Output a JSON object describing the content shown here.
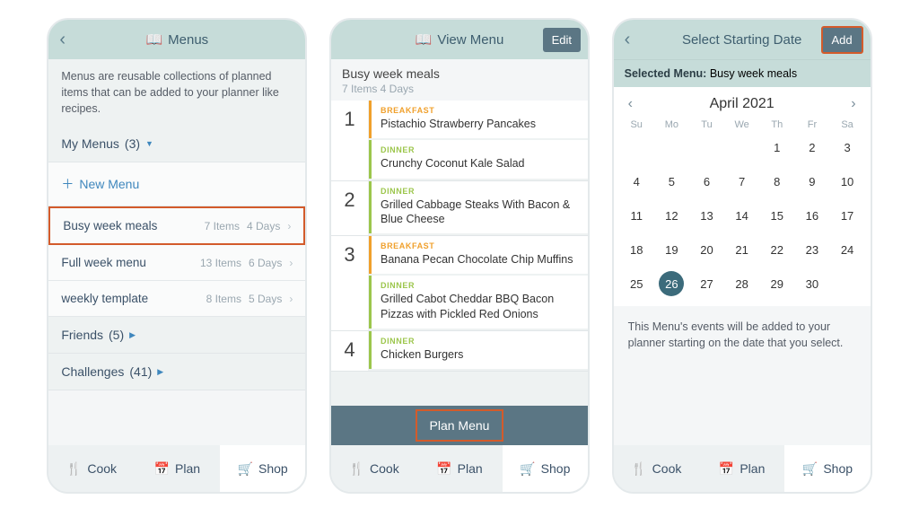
{
  "phone1": {
    "title": "Menus",
    "desc": "Menus are reusable collections of planned items that can be added to your planner like recipes.",
    "myMenus": {
      "label": "My Menus",
      "count": "(3)"
    },
    "newMenu": "New Menu",
    "rows": [
      {
        "name": "Busy week meals",
        "items": "7 Items",
        "days": "4 Days",
        "highlight": true
      },
      {
        "name": "Full week menu",
        "items": "13 Items",
        "days": "6 Days",
        "highlight": false
      },
      {
        "name": "weekly template",
        "items": "8 Items",
        "days": "5 Days",
        "highlight": false
      }
    ],
    "friends": {
      "label": "Friends",
      "count": "(5)"
    },
    "challenges": {
      "label": "Challenges",
      "count": "(41)"
    }
  },
  "phone2": {
    "title": "View Menu",
    "edit": "Edit",
    "name": "Busy week meals",
    "meta": "7 Items   4 Days",
    "labels": {
      "breakfast": "BREAKFAST",
      "dinner": "DINNER"
    },
    "days": [
      {
        "n": "1",
        "meals": [
          {
            "type": "breakfast",
            "dish": "Pistachio Strawberry Pancakes"
          },
          {
            "type": "dinner",
            "dish": "Crunchy Coconut Kale Salad"
          }
        ]
      },
      {
        "n": "2",
        "meals": [
          {
            "type": "dinner",
            "dish": "Grilled Cabbage Steaks With Bacon & Blue Cheese"
          }
        ]
      },
      {
        "n": "3",
        "meals": [
          {
            "type": "breakfast",
            "dish": "Banana Pecan Chocolate Chip Muffins"
          },
          {
            "type": "dinner",
            "dish": "Grilled Cabot Cheddar BBQ Bacon Pizzas with Pickled Red Onions"
          }
        ]
      },
      {
        "n": "4",
        "meals": [
          {
            "type": "dinner",
            "dish": "Chicken Burgers"
          }
        ]
      }
    ],
    "planMenu": "Plan Menu"
  },
  "phone3": {
    "title": "Select Starting Date",
    "add": "Add",
    "selectedLabel": "Selected Menu:",
    "selectedMenu": "Busy week meals",
    "month": "April 2021",
    "dow": [
      "Su",
      "Mo",
      "Tu",
      "We",
      "Th",
      "Fr",
      "Sa"
    ],
    "firstWeekday": 4,
    "lastDay": 30,
    "selectedDay": 26,
    "note": "This Menu's events will be added to your planner starting on the date that you select."
  },
  "nav": {
    "cook": "Cook",
    "plan": "Plan",
    "shop": "Shop"
  }
}
